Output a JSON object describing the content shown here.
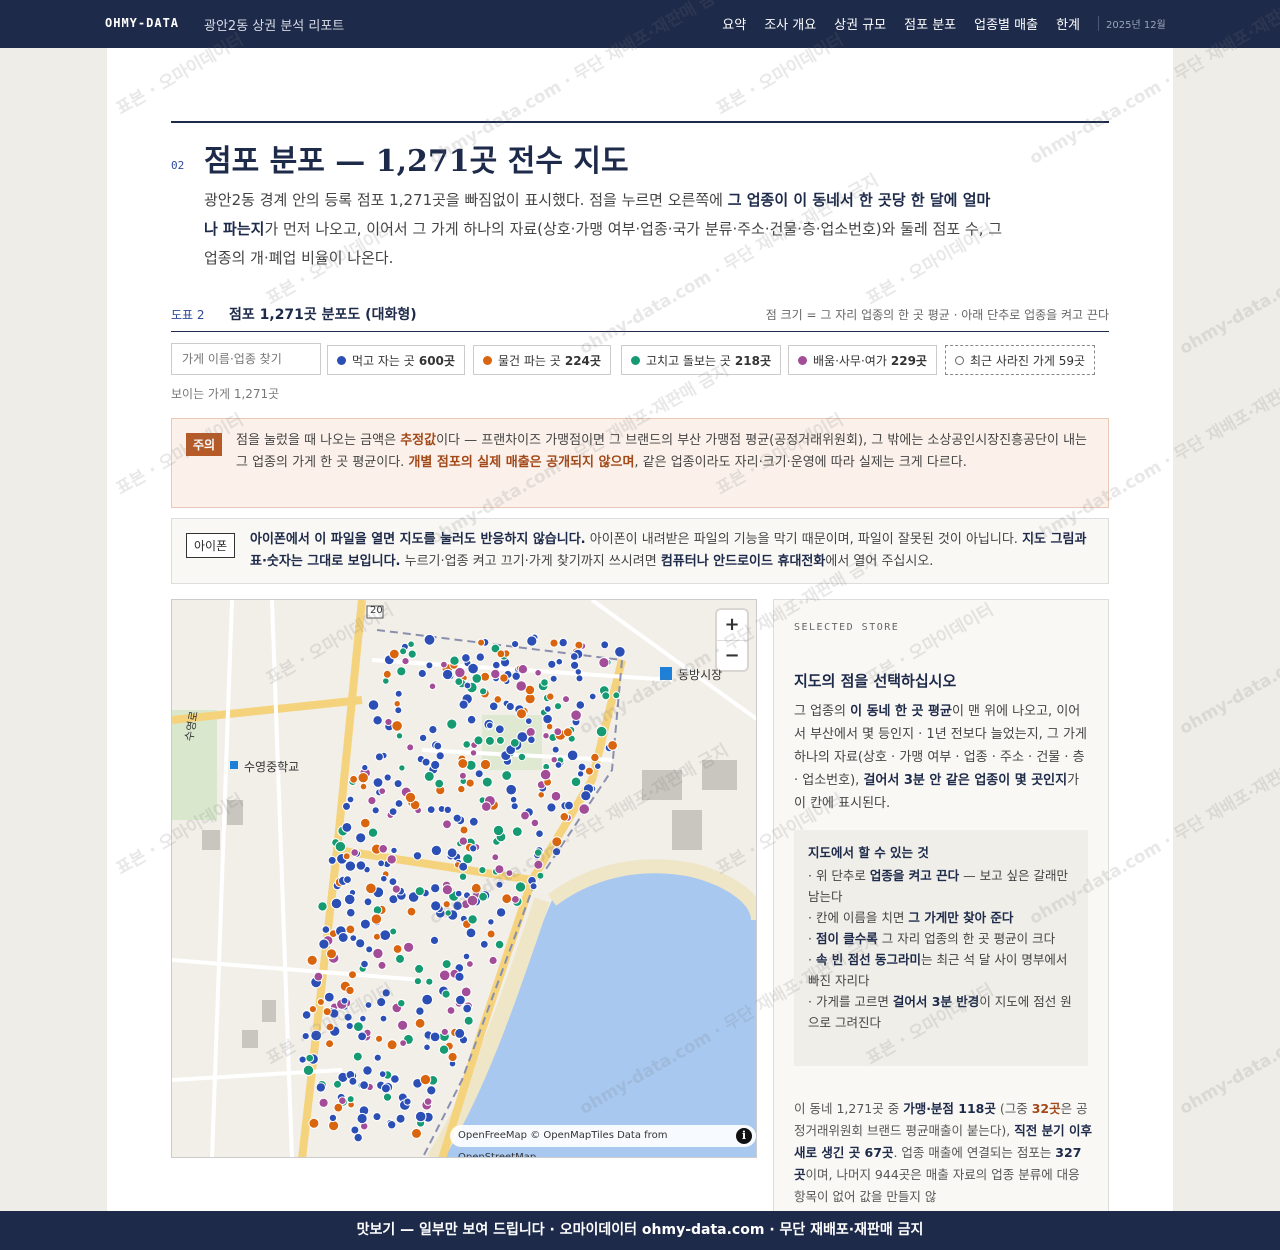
{
  "header": {
    "brand": "OHMY-DATA",
    "subtitle": "광안2동 상권 분석 리포트",
    "nav": [
      "요약",
      "조사 개요",
      "상권 규모",
      "점포 분포",
      "업종별 매출",
      "한계"
    ],
    "date": "2025년 12월"
  },
  "section": {
    "number": "02",
    "title": "점포 분포 — 1,271곳 전수 지도",
    "intro_1": "광안2동 경계 안의 등록 점포 1,271곳을 빠짐없이 표시했다. 점을 누르면 오른쪽에 ",
    "intro_bold": "그 업종이 이 동네서 한 곳당 한 달에 얼마나 파는지",
    "intro_2": "가 먼저 나오고, 이어서 그 가게 하나의 자료(상호·가맹 여부·업종·국가 분류·주소·건물·층·업소번호)와 둘레 점포 수, 그 업종의 개·폐업 비율이 나온다."
  },
  "figure": {
    "label": "도표 2",
    "title": "점포 1,271곳 분포도 (대화형)",
    "note": "점 크기 = 그 자리 업종의 한 곳 평균 · 아래 단추로 업종을 켜고 끈다"
  },
  "filters": {
    "search_placeholder": "가게 이름·업종 찾기",
    "chips": [
      {
        "label": "먹고 자는 곳",
        "count": "600곳",
        "color": "#2b4fb5"
      },
      {
        "label": "물건 파는 곳",
        "count": "224곳",
        "color": "#d9650f"
      },
      {
        "label": "고치고 돌보는 곳",
        "count": "218곳",
        "color": "#159a72"
      },
      {
        "label": "배움·사무·여가",
        "count": "229곳",
        "color": "#a34c98"
      },
      {
        "label": "최근 사라진 가게 59곳",
        "count": "",
        "color": "#666666"
      }
    ],
    "visible_count": "보이는 가게 1,271곳"
  },
  "warning": {
    "tag": "주의",
    "t1": "점을 눌렀을 때 나오는 금액은 ",
    "b1": "추정값",
    "t2": "이다 — 프랜차이즈 가맹점이면 그 브랜드의 부산 가맹점 평균(공정거래위원회), 그 밖에는 소상공인시장진흥공단이 내는 그 업종의 가게 한 곳 평균이다. ",
    "b2": "개별 점포의 실제 매출은 공개되지 않으며",
    "t3": ", 같은 업종이라도 자리·크기·운영에 따라 실제는 크게 다르다."
  },
  "iphone": {
    "tag": "아이폰",
    "b1": "아이폰에서 이 파일을 열면 지도를 눌러도 반응하지 않습니다.",
    "t1": " 아이폰이 내려받은 파일의 기능을 막기 때문이며, 파일이 잘못된 것이 아닙니다. ",
    "b2": "지도 그림과 표·숫자는 그대로 보입니다.",
    "t2": " 누르기·업종 켜고 끄기·가게 찾기까지 쓰시려면 ",
    "b3": "컴퓨터나 안드로이드 휴대전화",
    "t3": "에서 열어 주십시오."
  },
  "map": {
    "zoom_in": "+",
    "zoom_out": "−",
    "attribution": "OpenFreeMap © OpenMapTiles Data from OpenStreetMap",
    "info": "i",
    "road_number": "20",
    "labels": [
      "수영중학교",
      "동방시장",
      "수영로"
    ]
  },
  "side": {
    "kicker": "SELECTED STORE",
    "title": "지도의 점을 선택하십시오",
    "d1": "그 업종의 ",
    "db1": "이 동네 한 곳 평균",
    "d2": "이 맨 위에 나오고, 이어서 부산에서 몇 등인지 · 1년 전보다 늘었는지, 그 가게 하나의 자료(상호 · 가맹 여부 · 업종 · 주소 · 건물 · 층 · 업소번호), ",
    "db2": "걸어서 3분 안 같은 업종이 몇 곳인지",
    "d3": "가 이 칸에 표시된다.",
    "howto_title": "지도에서 할 수 있는 것",
    "h1a": "· 위 단추로 ",
    "h1b": "업종을 켜고 끈다",
    "h1c": " — 보고 싶은 갈래만 남는다",
    "h2a": "· 칸에 이름을 치면 ",
    "h2b": "그 가게만 찾아 준다",
    "h3a": "· ",
    "h3b": "점이 클수록",
    "h3c": " 그 자리 업종의 한 곳 평균이 크다",
    "h4a": "· ",
    "h4b": "속 빈 점선 동그라미",
    "h4c": "는 최근 석 달 사이 명부에서 빠진 자리다",
    "h5a": "· 가게를 고르면 ",
    "h5b": "걸어서 3분 반경",
    "h5c": "이 지도에 점선 원으로 그려진다",
    "f1": "이 동네 1,271곳 중 ",
    "fb1": "가맹·분점 118곳",
    "f2": " (그중 ",
    "fo1": "32곳",
    "f3": "은 공정거래위원회 브랜드 평균매출이 붙는다), ",
    "fb2": "직전 분기 이후 새로 생긴 곳 67곳",
    "f4": ". 업종 매출에 연결되는 점포는 ",
    "fb3": "327곳",
    "f5": "이며, 나머지 944곳은 매출 자료의 업종 분류에 대응 항목이 없어 값을 만들지 않"
  },
  "footer": {
    "text": "맛보기 — 일부만 보여 드립니다 · 오마이데이터 ohmy-data.com · 무단 재배포·재판매 금지"
  },
  "watermark": {
    "a": "표본 · 오마이데이터",
    "b": "ohmy-data.com · 무단 재배포·재판매 금지"
  }
}
